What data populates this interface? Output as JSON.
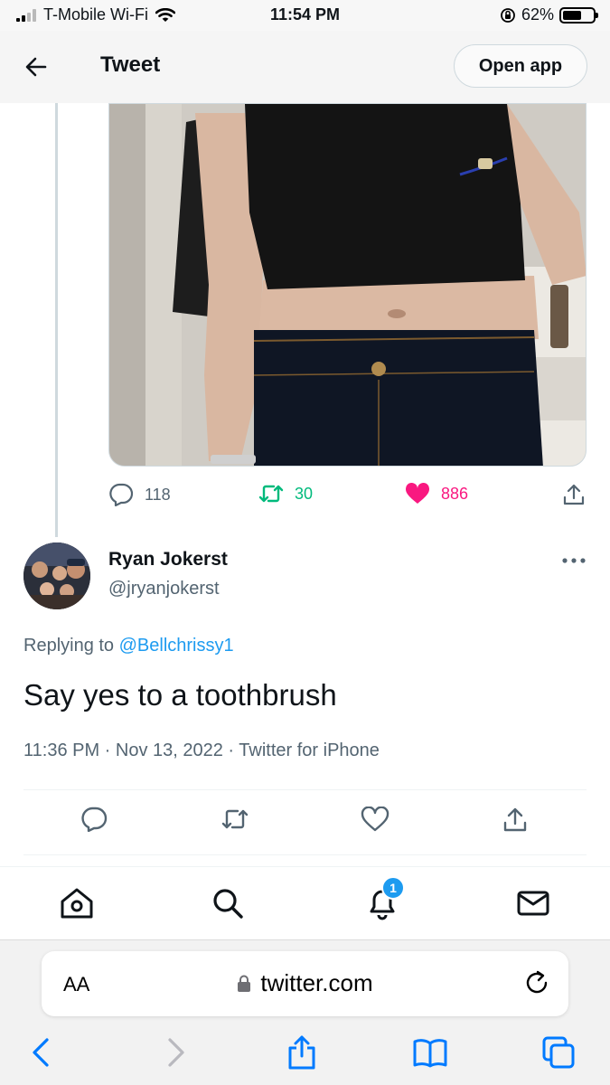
{
  "status_bar": {
    "carrier": "T-Mobile Wi-Fi",
    "time": "11:54 PM",
    "battery": "62%",
    "battery_level": 0.62
  },
  "header": {
    "title": "Tweet",
    "open_app_label": "Open app"
  },
  "parent_tweet": {
    "reply_count": "118",
    "retweet_count": "30",
    "like_count": "886",
    "colors": {
      "retweet": "#00ba7c",
      "like": "#f91880"
    }
  },
  "reply": {
    "author_name": "Ryan Jokerst",
    "author_handle": "@jryanjokerst",
    "replying_prefix": "Replying to",
    "replying_to": "@Bellchrissy1",
    "text": "Say yes to a toothbrush",
    "meta": "11:36 PM · Nov 13, 2022 · Twitter for iPhone"
  },
  "nav": {
    "notifications_badge": "1",
    "items": [
      "home-icon",
      "search-icon",
      "bell-icon",
      "mail-icon"
    ]
  },
  "browser": {
    "aa_label": "AA",
    "url": "twitter.com"
  },
  "colors": {
    "accent": "#1d9bf0",
    "text": "#0f1419",
    "secondary": "#536471"
  }
}
